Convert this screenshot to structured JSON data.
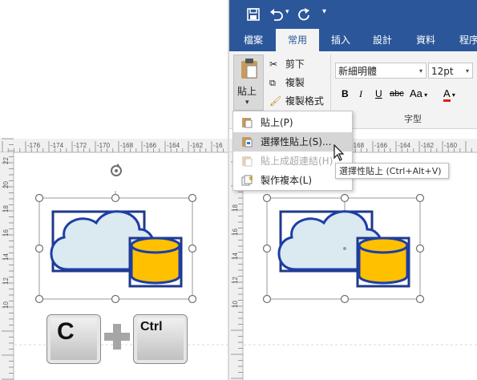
{
  "ribbon": {
    "quick_access": {
      "save_icon": "save-icon",
      "undo_icon": "undo-icon",
      "redo_icon": "redo-icon",
      "more_icon": "customize-icon"
    },
    "tabs": [
      {
        "label": "檔案",
        "active": false
      },
      {
        "label": "常用",
        "active": true
      },
      {
        "label": "插入",
        "active": false
      },
      {
        "label": "設計",
        "active": false
      },
      {
        "label": "資料",
        "active": false
      },
      {
        "label": "程序",
        "active": false
      }
    ],
    "paste_label": "貼上",
    "cut_label": "剪下",
    "copy_label": "複製",
    "format_painter_label": "複製格式",
    "font_name": "新細明體",
    "font_size": "12pt",
    "bold": "B",
    "italic": "I",
    "underline": "U",
    "strikethrough": "abc",
    "change_case": "Aa",
    "font_color": "A",
    "font_group_label": "字型",
    "font_color_hex": "#e01b1b"
  },
  "paste_menu": {
    "items": [
      {
        "label": "貼上(P)",
        "icon": "paste-icon",
        "state": "normal"
      },
      {
        "label": "選擇性貼上(S)...",
        "icon": "paste-special-icon",
        "state": "highlighted"
      },
      {
        "label": "貼上成超連結(H)",
        "icon": "paste-hyperlink-icon",
        "state": "disabled"
      },
      {
        "label": "製作複本(L)",
        "icon": "duplicate-icon",
        "state": "normal"
      }
    ]
  },
  "tooltip": "選擇性貼上 (Ctrl+Alt+V)",
  "left_ruler": {
    "top_ticks": [
      "-176",
      "-174",
      "-172",
      "-170",
      "-168",
      "-166",
      "-164",
      "-162",
      "-16"
    ],
    "side_ticks": [
      "22",
      "20",
      "18",
      "16",
      "14",
      "12",
      "10"
    ]
  },
  "right_ruler": {
    "top_ticks": [
      "-168",
      "-166",
      "-164",
      "-162",
      "-160"
    ],
    "side_ticks": [
      "20",
      "18",
      "16",
      "14",
      "12",
      "10"
    ]
  },
  "keys": {
    "c_key": "C",
    "plus": "+",
    "ctrl_key": "Ctrl"
  },
  "colors": {
    "ribbon_blue": "#2b579a",
    "cloud_fill": "#dbe9f1",
    "shape_stroke": "#1c3ea8",
    "cylinder_fill": "#ffc000"
  }
}
